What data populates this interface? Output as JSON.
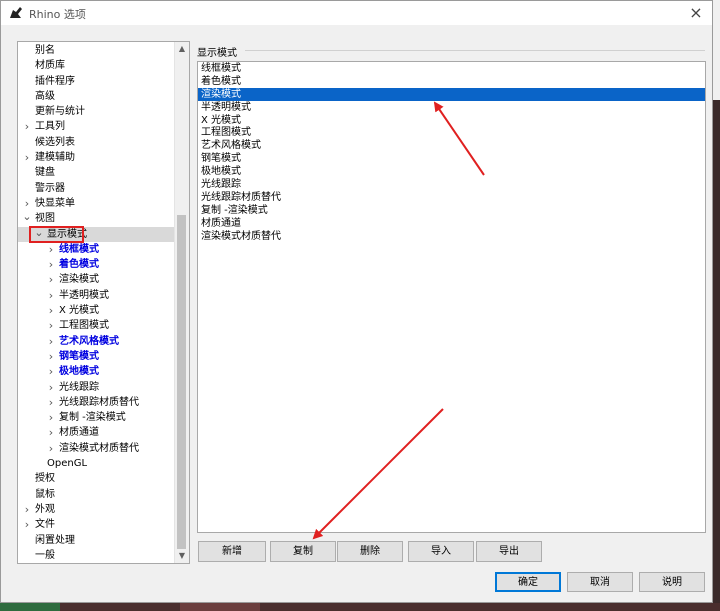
{
  "window": {
    "title": "Rhino 选项",
    "close_label": "×"
  },
  "tree": {
    "items": [
      {
        "label": "别名",
        "level": 0,
        "chevron": "",
        "blue": false
      },
      {
        "label": "材质库",
        "level": 0,
        "chevron": "",
        "blue": false
      },
      {
        "label": "插件程序",
        "level": 0,
        "chevron": "",
        "blue": false
      },
      {
        "label": "高级",
        "level": 0,
        "chevron": "",
        "blue": false
      },
      {
        "label": "更新与统计",
        "level": 0,
        "chevron": "",
        "blue": false
      },
      {
        "label": "工具列",
        "level": 0,
        "chevron": ">",
        "blue": false
      },
      {
        "label": "候选列表",
        "level": 0,
        "chevron": "",
        "blue": false
      },
      {
        "label": "建模辅助",
        "level": 0,
        "chevron": ">",
        "blue": false
      },
      {
        "label": "键盘",
        "level": 0,
        "chevron": "",
        "blue": false
      },
      {
        "label": "警示器",
        "level": 0,
        "chevron": "",
        "blue": false
      },
      {
        "label": "快显菜单",
        "level": 0,
        "chevron": ">",
        "blue": false
      },
      {
        "label": "视图",
        "level": 0,
        "chevron": "v",
        "blue": false
      },
      {
        "label": "显示模式",
        "level": 1,
        "chevron": "v",
        "blue": false,
        "selected": true
      },
      {
        "label": "线框模式",
        "level": 2,
        "chevron": ">",
        "blue": true
      },
      {
        "label": "着色模式",
        "level": 2,
        "chevron": ">",
        "blue": true
      },
      {
        "label": "渲染模式",
        "level": 2,
        "chevron": ">",
        "blue": false
      },
      {
        "label": "半透明模式",
        "level": 2,
        "chevron": ">",
        "blue": false
      },
      {
        "label": "X 光模式",
        "level": 2,
        "chevron": ">",
        "blue": false
      },
      {
        "label": "工程图模式",
        "level": 2,
        "chevron": ">",
        "blue": false
      },
      {
        "label": "艺术风格模式",
        "level": 2,
        "chevron": ">",
        "blue": true
      },
      {
        "label": "钢笔模式",
        "level": 2,
        "chevron": ">",
        "blue": true
      },
      {
        "label": "极地模式",
        "level": 2,
        "chevron": ">",
        "blue": true
      },
      {
        "label": "光线跟踪",
        "level": 2,
        "chevron": ">",
        "blue": false
      },
      {
        "label": "光线跟踪材质替代",
        "level": 2,
        "chevron": ">",
        "blue": false
      },
      {
        "label": "复制 -渲染模式",
        "level": 2,
        "chevron": ">",
        "blue": false
      },
      {
        "label": "材质通道",
        "level": 2,
        "chevron": ">",
        "blue": false
      },
      {
        "label": "渲染模式材质替代",
        "level": 2,
        "chevron": ">",
        "blue": false
      },
      {
        "label": "OpenGL",
        "level": 1,
        "chevron": "",
        "blue": false
      },
      {
        "label": "授权",
        "level": 0,
        "chevron": "",
        "blue": false
      },
      {
        "label": "鼠标",
        "level": 0,
        "chevron": "",
        "blue": false
      },
      {
        "label": "外观",
        "level": 0,
        "chevron": ">",
        "blue": false
      },
      {
        "label": "文件",
        "level": 0,
        "chevron": ">",
        "blue": false
      },
      {
        "label": "闲置处理",
        "level": 0,
        "chevron": "",
        "blue": false
      },
      {
        "label": "一般",
        "level": 0,
        "chevron": "",
        "blue": false
      }
    ]
  },
  "display_modes": {
    "group_label": "显示模式",
    "items": [
      {
        "label": "线框模式",
        "selected": false
      },
      {
        "label": "着色模式",
        "selected": false
      },
      {
        "label": "渲染模式",
        "selected": true
      },
      {
        "label": "半透明模式",
        "selected": false
      },
      {
        "label": "X 光模式",
        "selected": false
      },
      {
        "label": "工程图模式",
        "selected": false
      },
      {
        "label": "艺术风格模式",
        "selected": false
      },
      {
        "label": "钢笔模式",
        "selected": false
      },
      {
        "label": "极地模式",
        "selected": false
      },
      {
        "label": "光线跟踪",
        "selected": false
      },
      {
        "label": "光线跟踪材质替代",
        "selected": false
      },
      {
        "label": "复制 -渲染模式",
        "selected": false
      },
      {
        "label": "材质通道",
        "selected": false
      },
      {
        "label": "渲染模式材质替代",
        "selected": false
      }
    ]
  },
  "buttons": {
    "new": "新增",
    "copy": "复制",
    "delete": "删除",
    "import": "导入",
    "export": "导出",
    "ok": "确定",
    "cancel": "取消",
    "help": "说明"
  },
  "colors": {
    "selection": "#0a64c8",
    "tree_blue_text": "#0000e0",
    "annotation_red": "#e02020"
  }
}
